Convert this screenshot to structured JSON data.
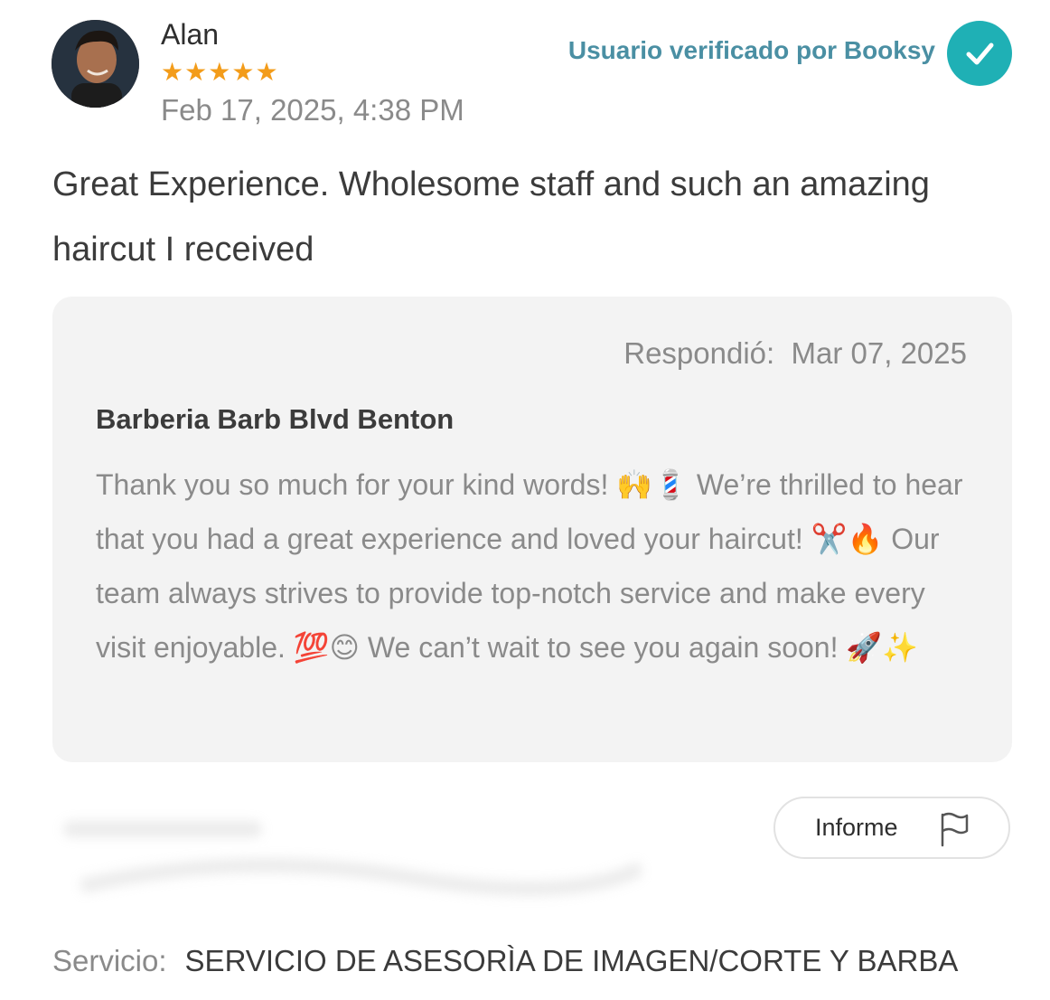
{
  "reviewer": {
    "name": "Alan",
    "rating": 5,
    "rating_max": 5,
    "date": "Feb 17, 2025, 4:38 PM"
  },
  "verified": {
    "label": "Usuario verificado por Booksy",
    "icon": "check-icon",
    "color": "#1fb0b5"
  },
  "review": {
    "text": "Great Experience. Wholesome staff and such an amazing haircut I received"
  },
  "reply": {
    "date_label": "Respondió:",
    "date": "Mar 07, 2025",
    "business_name": "Barberia Barb Blvd Benton",
    "text": "Thank you so much for your kind words! 🙌💈 We’re thrilled to hear that you had a great experience and loved your haircut! ✂️🔥 Our team always strives to provide top-notch service and make every visit enjoyable. 💯😊 We can’t wait to see you again soon! 🚀✨"
  },
  "report_button": {
    "label": "Informe",
    "icon": "flag-icon"
  },
  "service": {
    "label": "Servicio:",
    "value": "SERVICIO DE ASESORÌA DE IMAGEN/CORTE Y BARBA"
  },
  "colors": {
    "star": "#f39c1a",
    "verified_text": "#4a8fa3",
    "reply_background": "#f3f3f3"
  }
}
